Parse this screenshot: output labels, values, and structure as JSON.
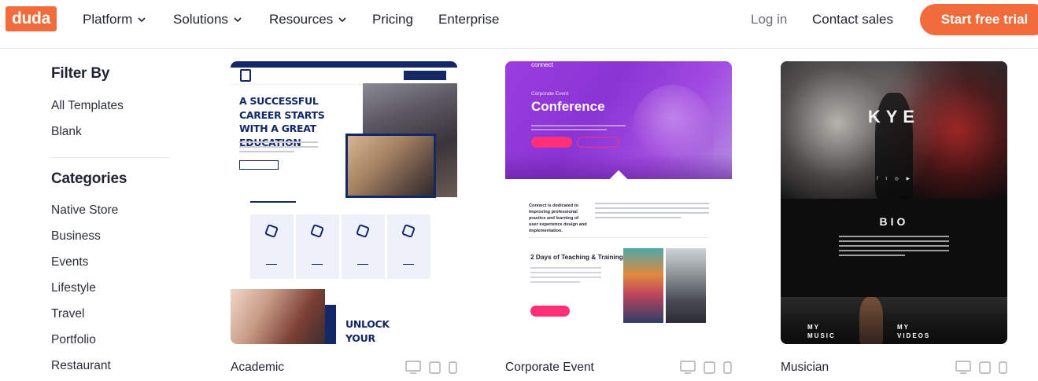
{
  "nav": {
    "logo": "duda",
    "items": [
      {
        "label": "Platform",
        "has_dropdown": true
      },
      {
        "label": "Solutions",
        "has_dropdown": true
      },
      {
        "label": "Resources",
        "has_dropdown": true
      },
      {
        "label": "Pricing",
        "has_dropdown": false
      },
      {
        "label": "Enterprise",
        "has_dropdown": false
      }
    ],
    "login": "Log in",
    "contact": "Contact sales",
    "cta": "Start free trial"
  },
  "sidebar": {
    "filter_title": "Filter By",
    "filter_items": [
      "All Templates",
      "Blank"
    ],
    "categories_title": "Categories",
    "categories": [
      "Native Store",
      "Business",
      "Events",
      "Lifestyle",
      "Travel",
      "Portfolio",
      "Restaurant"
    ]
  },
  "cards": [
    {
      "title": "Academic",
      "preview": {
        "headline": "A SUCCESSFUL CAREER STARTS WITH A GREAT EDUCATION",
        "cta": "UNLOCK YOUR POTENTIAL"
      }
    },
    {
      "title": "Corporate Event",
      "preview": {
        "logo": "connect",
        "subtitle": "Corporate Event",
        "headline": "Conference",
        "intro": "Connect is dedicated to improving professional practice and learning of user experience design and implementation.",
        "section": "2 Days of Teaching & Training"
      }
    },
    {
      "title": "Musician",
      "preview": {
        "name": "KYE",
        "section": "BIO",
        "link_music": "MY MUSIC",
        "link_videos": "MY VIDEOS"
      }
    }
  ],
  "devices": [
    "desktop-icon",
    "tablet-icon",
    "mobile-icon"
  ],
  "colors": {
    "brand": "#f26b3a",
    "academic_navy": "#132866",
    "event_purple": "#9b3de0",
    "event_pink": "#ff2f78"
  }
}
